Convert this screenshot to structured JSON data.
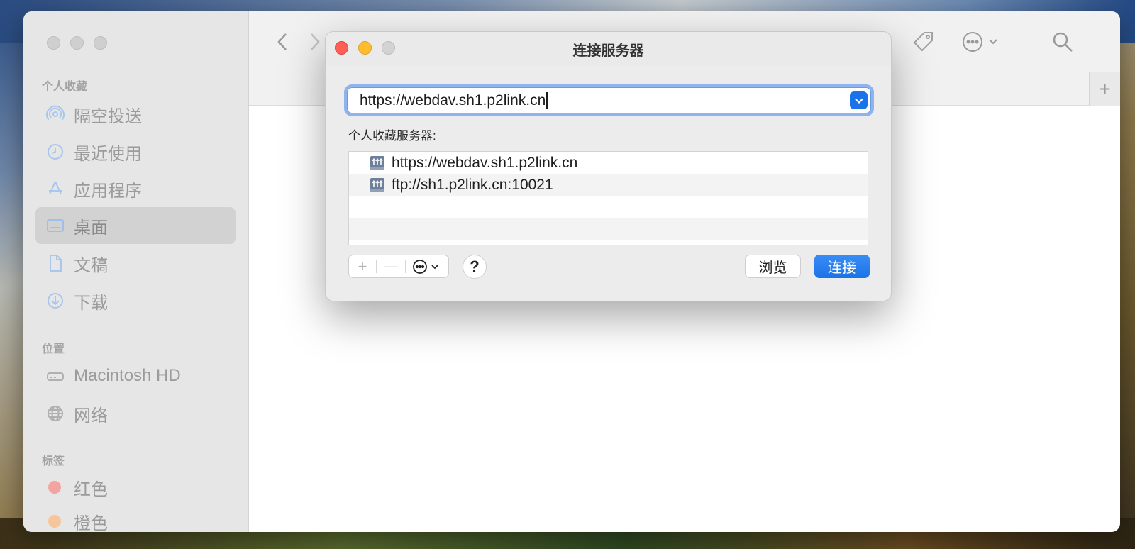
{
  "finder": {
    "sidebar": {
      "sections": {
        "favorites": "个人收藏",
        "locations": "位置",
        "tags": "标签"
      },
      "favorites": [
        {
          "label": "隔空投送",
          "icon": "airdrop-icon"
        },
        {
          "label": "最近使用",
          "icon": "clock-icon"
        },
        {
          "label": "应用程序",
          "icon": "app-store-icon"
        },
        {
          "label": "桌面",
          "icon": "desktop-icon",
          "selected": true
        },
        {
          "label": "文稿",
          "icon": "document-icon"
        },
        {
          "label": "下载",
          "icon": "download-icon"
        }
      ],
      "locations": [
        {
          "label": "Macintosh HD",
          "icon": "hard-drive-icon"
        },
        {
          "label": "网络",
          "icon": "globe-icon"
        }
      ],
      "tags": [
        {
          "label": "红色",
          "color": "#f3a3a0"
        },
        {
          "label": "橙色",
          "color": "#f7c59a"
        }
      ]
    },
    "toolbar": {
      "tab_plus": "+"
    }
  },
  "dialog": {
    "title": "连接服务器",
    "url_value": "https://webdav.sh1.p2link.cn",
    "favorites_label": "个人收藏服务器:",
    "favorites": [
      "https://webdav.sh1.p2link.cn",
      "ftp://sh1.p2link.cn:10021"
    ],
    "add_label": "+",
    "remove_label": "—",
    "help_label": "?",
    "browse_label": "浏览",
    "connect_label": "连接"
  },
  "colors": {
    "accent": "#1a73e8",
    "close": "#fe5f57",
    "minimize": "#febc2e"
  }
}
